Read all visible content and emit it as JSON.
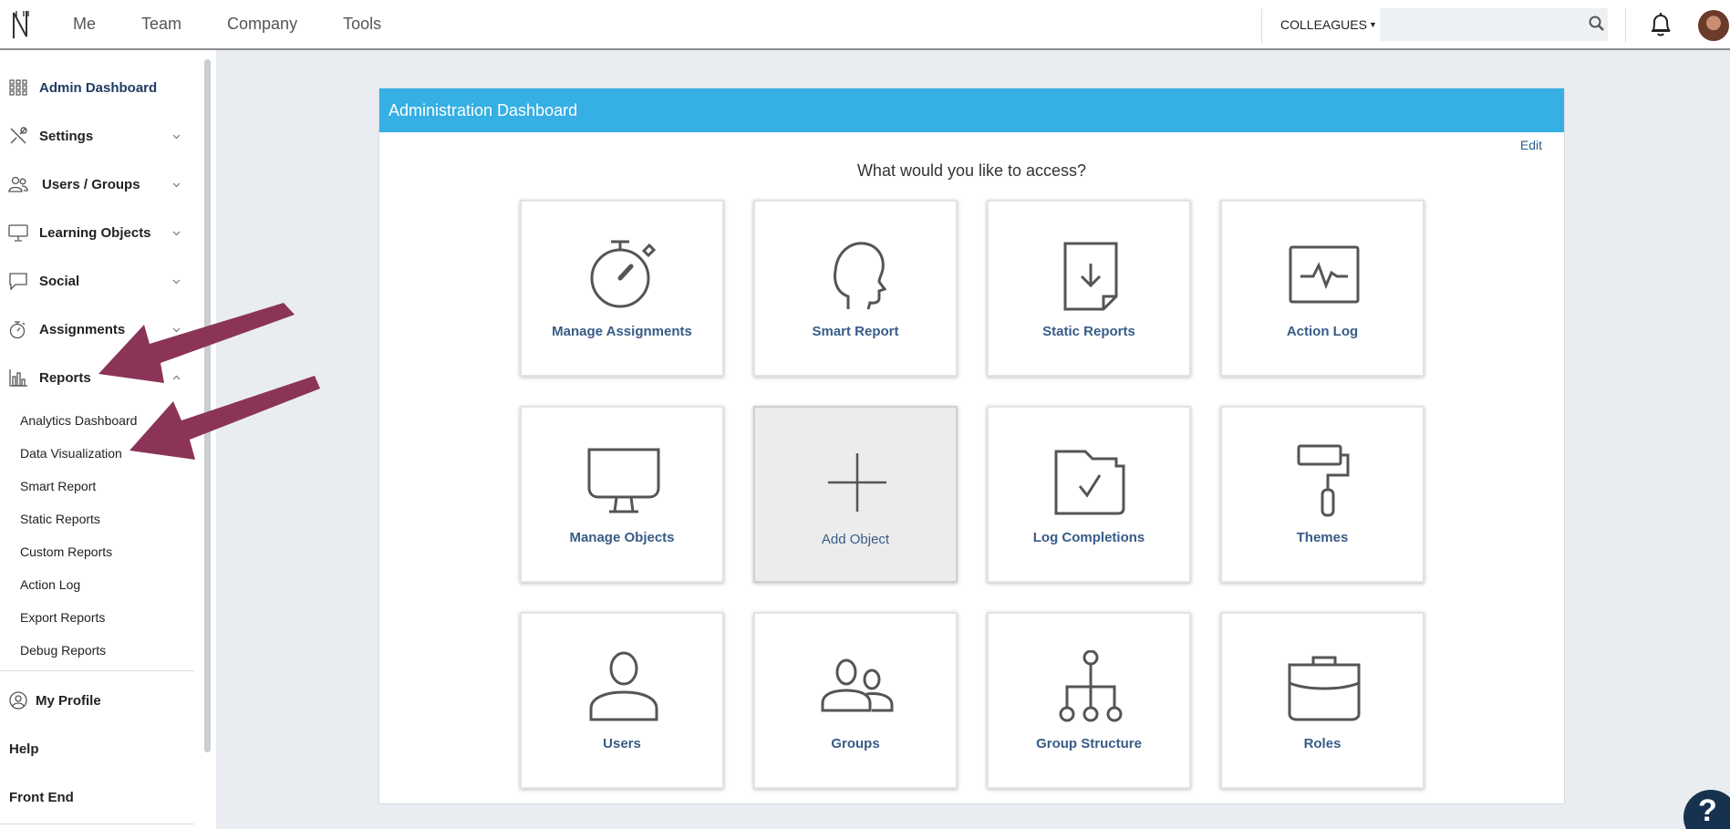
{
  "topbar": {
    "nav": [
      "Me",
      "Team",
      "Company",
      "Tools"
    ],
    "colleagues_label": "COLLEAGUES",
    "search_placeholder": ""
  },
  "sidebar": {
    "items": [
      {
        "label": "Admin Dashboard",
        "icon": "grid-icon",
        "active": true
      },
      {
        "label": "Settings",
        "icon": "tools-icon"
      },
      {
        "label": "Users / Groups",
        "icon": "users-icon"
      },
      {
        "label": "Learning Objects",
        "icon": "monitor-icon"
      },
      {
        "label": "Social",
        "icon": "speech-bubble-icon"
      },
      {
        "label": "Assignments",
        "icon": "stopwatch-icon"
      },
      {
        "label": "Reports",
        "icon": "bar-chart-icon",
        "expanded": true
      }
    ],
    "report_subitems": [
      "Analytics Dashboard",
      "Data Visualization",
      "Smart Report",
      "Static Reports",
      "Custom Reports",
      "Action Log",
      "Export Reports",
      "Debug Reports"
    ],
    "my_profile": "My Profile",
    "help": "Help",
    "front_end": "Front End"
  },
  "main": {
    "title": "Administration Dashboard",
    "edit_label": "Edit",
    "prompt": "What would you like to access?",
    "tiles": [
      {
        "label": "Manage Assignments",
        "icon": "stopwatch-icon"
      },
      {
        "label": "Smart Report",
        "icon": "head-profile-icon"
      },
      {
        "label": "Static Reports",
        "icon": "document-download-icon"
      },
      {
        "label": "Action Log",
        "icon": "pulse-monitor-icon"
      },
      {
        "label": "Manage Objects",
        "icon": "monitor-icon"
      },
      {
        "label": "Add Object",
        "icon": "plus-icon"
      },
      {
        "label": "Log Completions",
        "icon": "folder-check-icon"
      },
      {
        "label": "Themes",
        "icon": "paint-roller-icon"
      },
      {
        "label": "Users",
        "icon": "user-icon"
      },
      {
        "label": "Groups",
        "icon": "group-icon"
      },
      {
        "label": "Group Structure",
        "icon": "hierarchy-icon"
      },
      {
        "label": "Roles",
        "icon": "briefcase-icon"
      }
    ]
  },
  "help_button": "?",
  "colors": {
    "header_blue": "#35afe4",
    "tile_label": "#385c87",
    "arrow": "#8b3458",
    "help_bg": "#17324f"
  }
}
